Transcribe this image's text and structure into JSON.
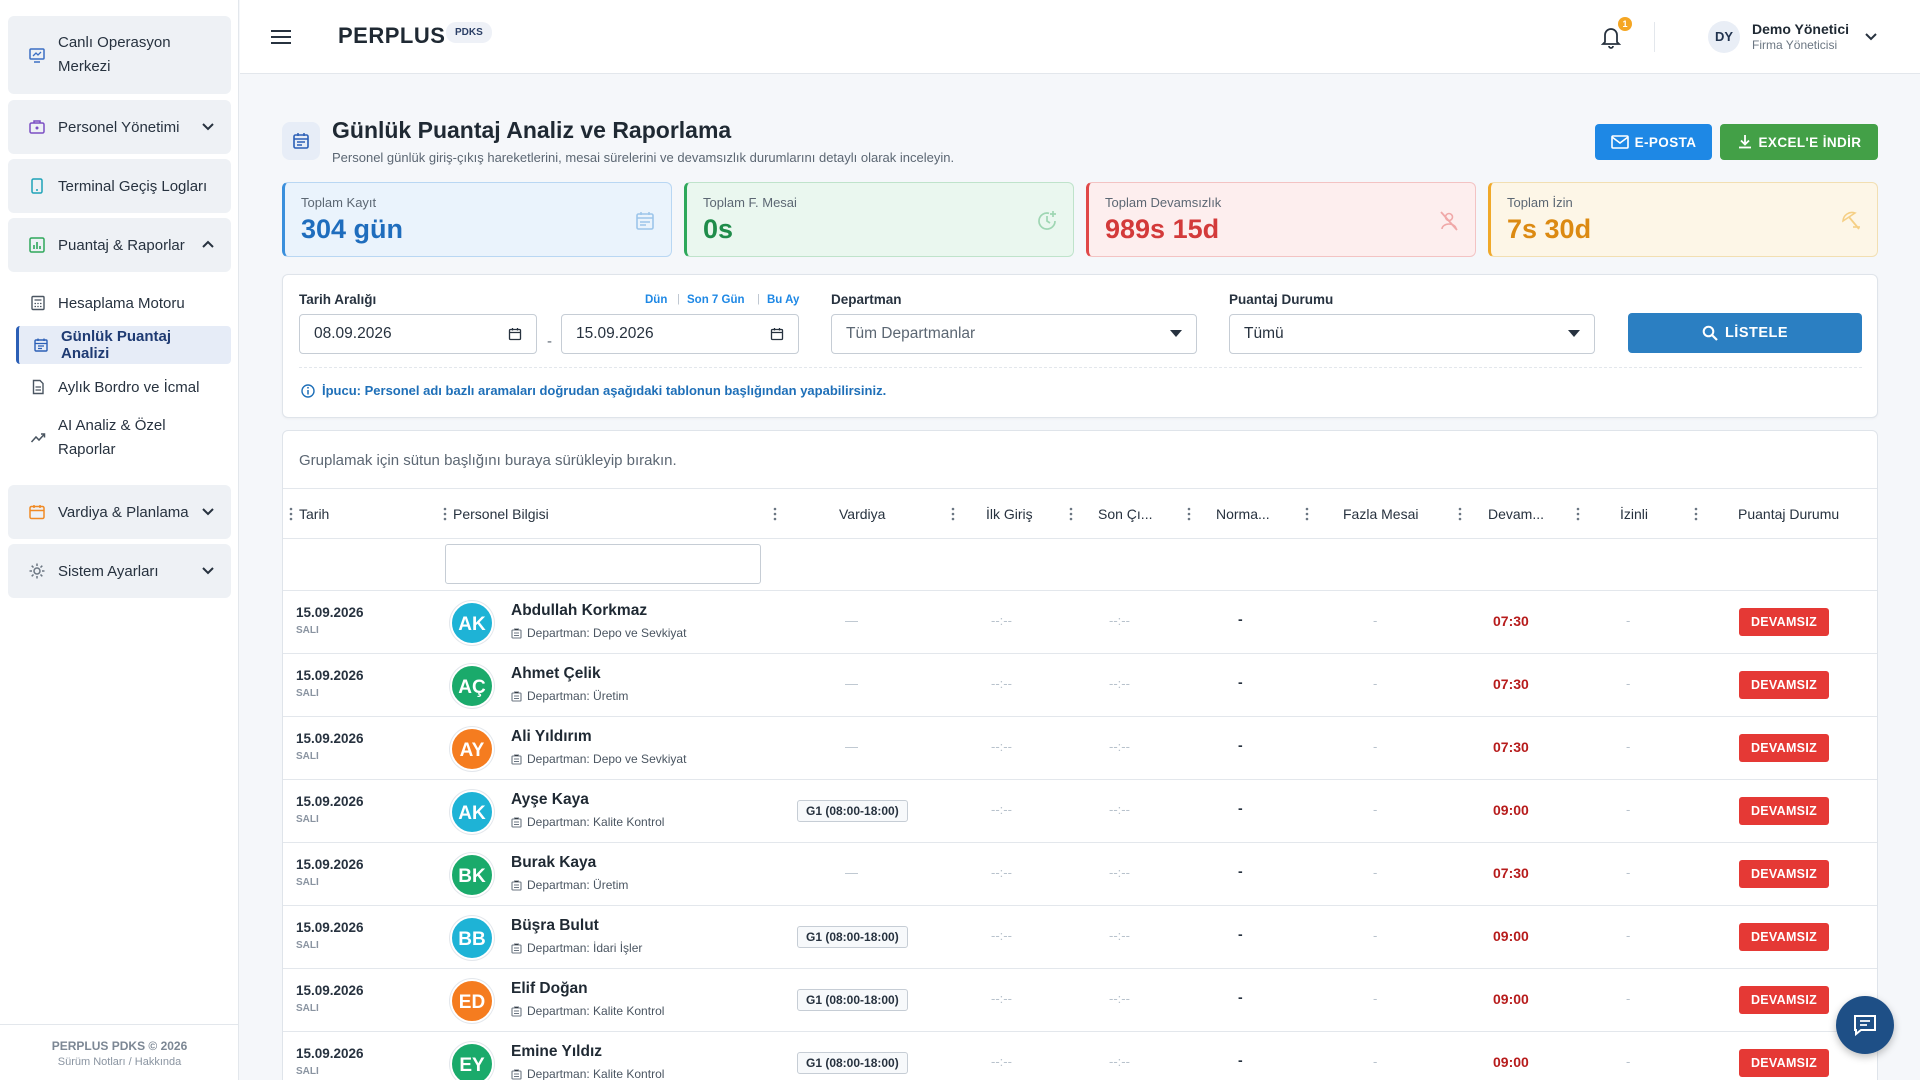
{
  "sidebar": {
    "groups": [
      {
        "label": "Canlı Operasyon Merkezi"
      },
      {
        "label": "Personel Yönetimi"
      },
      {
        "label": "Terminal Geçiş Logları"
      },
      {
        "label": "Puantaj & Raporlar"
      },
      {
        "label": "Vardiya & Planlama"
      },
      {
        "label": "Sistem Ayarları"
      }
    ],
    "sub_items": [
      {
        "label": "Hesaplama Motoru"
      },
      {
        "label": "Günlük Puantaj Analizi"
      },
      {
        "label": "Aylık Bordro ve İcmal"
      },
      {
        "label": "AI Analiz & Özel Raporlar"
      }
    ],
    "footer": {
      "copyright": "PERPLUS PDKS © 2026",
      "links": "Sürüm Notları / Hakkında"
    }
  },
  "header": {
    "brand": "PERPLUS",
    "badge": "PDKS",
    "notification_count": "1",
    "user": {
      "initials": "DY",
      "name": "Demo Yönetici",
      "role": "Firma Yöneticisi"
    }
  },
  "page": {
    "title": "Günlük Puantaj Analiz ve Raporlama",
    "subtitle": "Personel günlük giriş-çıkış hareketlerini, mesai sürelerini ve devamsızlık durumlarını detaylı olarak inceleyin.",
    "email_button": "E-POSTA",
    "excel_button": "EXCEL'E İNDİR"
  },
  "stats": [
    {
      "label": "Toplam Kayıt",
      "value": "304 gün"
    },
    {
      "label": "Toplam F. Mesai",
      "value": "0s"
    },
    {
      "label": "Toplam Devamsızlık",
      "value": "989s 15d"
    },
    {
      "label": "Toplam İzin",
      "value": "7s 30d"
    }
  ],
  "filters": {
    "date_label": "Tarih Aralığı",
    "quick": [
      "Dün",
      "Son 7 Gün",
      "Bu Ay"
    ],
    "date_from": "08.09.2026",
    "date_to": "15.09.2026",
    "separator": "-",
    "department_label": "Departman",
    "department_value": "Tüm Departmanlar",
    "status_label": "Puantaj Durumu",
    "status_value": "Tümü",
    "list_button": "LİSTELE",
    "hint": "İpucu: Personel adı bazlı aramaları doğrudan aşağıdaki tablonun başlığından yapabilirsiniz."
  },
  "grid": {
    "group_panel": "Gruplamak için sütun başlığını buraya sürükleyip bırakın.",
    "columns": [
      "Tarih",
      "Personel Bilgisi",
      "Vardiya",
      "İlk Giriş",
      "Son Çı...",
      "Norma...",
      "Fazla Mesai",
      "Devam...",
      "İzinli",
      "Puantaj Durumu"
    ],
    "dept_prefix": "Departman: ",
    "rows": [
      {
        "date": "15.09.2026",
        "day": "SALI",
        "initials": "AK",
        "color": "#1eb3d6",
        "name": "Abdullah Korkmaz",
        "dept": "Departman: Depo ve Sevkiyat",
        "shift": "—",
        "first_in": "--:--",
        "last_out": "--:--",
        "normal": "-",
        "overtime": "-",
        "absent": "07:30",
        "leave": "-",
        "status": "DEVAMSIZ"
      },
      {
        "date": "15.09.2026",
        "day": "SALI",
        "initials": "AÇ",
        "color": "#1aaa6b",
        "name": "Ahmet Çelik",
        "dept": "Departman: Üretim",
        "shift": "—",
        "first_in": "--:--",
        "last_out": "--:--",
        "normal": "-",
        "overtime": "-",
        "absent": "07:30",
        "leave": "-",
        "status": "DEVAMSIZ"
      },
      {
        "date": "15.09.2026",
        "day": "SALI",
        "initials": "AY",
        "color": "#f57c1f",
        "name": "Ali Yıldırım",
        "dept": "Departman: Depo ve Sevkiyat",
        "shift": "—",
        "first_in": "--:--",
        "last_out": "--:--",
        "normal": "-",
        "overtime": "-",
        "absent": "07:30",
        "leave": "-",
        "status": "DEVAMSIZ"
      },
      {
        "date": "15.09.2026",
        "day": "SALI",
        "initials": "AK",
        "color": "#1eb3d6",
        "name": "Ayşe Kaya",
        "dept": "Departman: Kalite Kontrol",
        "shift": "G1 (08:00-18:00)",
        "first_in": "--:--",
        "last_out": "--:--",
        "normal": "-",
        "overtime": "-",
        "absent": "09:00",
        "leave": "-",
        "status": "DEVAMSIZ"
      },
      {
        "date": "15.09.2026",
        "day": "SALI",
        "initials": "BK",
        "color": "#1aaa6b",
        "name": "Burak Kaya",
        "dept": "Departman: Üretim",
        "shift": "—",
        "first_in": "--:--",
        "last_out": "--:--",
        "normal": "-",
        "overtime": "-",
        "absent": "07:30",
        "leave": "-",
        "status": "DEVAMSIZ"
      },
      {
        "date": "15.09.2026",
        "day": "SALI",
        "initials": "BB",
        "color": "#1eb3d6",
        "name": "Büşra Bulut",
        "dept": "Departman: İdari İşler",
        "shift": "G1 (08:00-18:00)",
        "first_in": "--:--",
        "last_out": "--:--",
        "normal": "-",
        "overtime": "-",
        "absent": "09:00",
        "leave": "-",
        "status": "DEVAMSIZ"
      },
      {
        "date": "15.09.2026",
        "day": "SALI",
        "initials": "ED",
        "color": "#f57c1f",
        "name": "Elif Doğan",
        "dept": "Departman: Kalite Kontrol",
        "shift": "G1 (08:00-18:00)",
        "first_in": "--:--",
        "last_out": "--:--",
        "normal": "-",
        "overtime": "-",
        "absent": "09:00",
        "leave": "-",
        "status": "DEVAMSIZ"
      },
      {
        "date": "15.09.2026",
        "day": "SALI",
        "initials": "EY",
        "color": "#1aaa6b",
        "name": "Emine Yıldız",
        "dept": "Departman: Kalite Kontrol",
        "shift": "G1 (08:00-18:00)",
        "first_in": "--:--",
        "last_out": "--:--",
        "normal": "-",
        "overtime": "-",
        "absent": "09:00",
        "leave": "-",
        "status": "DEVAMSIZ"
      }
    ]
  }
}
